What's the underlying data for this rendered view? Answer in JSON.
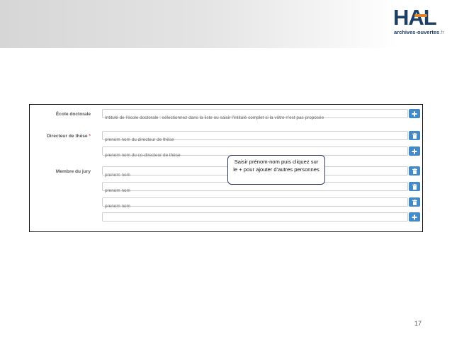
{
  "logo": {
    "name": "HAL",
    "sub_left": "archives-",
    "sub_right": "ouvertes",
    "sub_tld": ".fr"
  },
  "form": {
    "labels": {
      "ecole": "École doctorale",
      "directeur": "Directeur de thèse",
      "required_mark": "*",
      "jury": "Membre du jury"
    },
    "fields": [
      {
        "placeholder": "Intitulé de l'école doctorale : sélectionnez dans la liste ou saisir l'intitulé complet si la vôtre n'est pas proposée",
        "action": "add"
      },
      {
        "placeholder": "prenom nom du directeur de thèse",
        "action": "delete"
      },
      {
        "placeholder": "prenom nom du co-directeur de thèse",
        "action": "add"
      },
      {
        "placeholder": "prenom nom",
        "action": "delete"
      },
      {
        "placeholder": "prenom nom",
        "action": "delete"
      },
      {
        "placeholder": "prenom nom",
        "action": "delete"
      },
      {
        "placeholder": "",
        "action": "add"
      }
    ]
  },
  "tooltip": {
    "text": "Saisir prénom-nom puis cliquez sur le + pour ajouter d'autres personnes"
  },
  "page_number": "17",
  "colors": {
    "button": "#428bca",
    "logo": "#1d3f63",
    "accent": "#e0862a",
    "required": "#d9534f"
  }
}
